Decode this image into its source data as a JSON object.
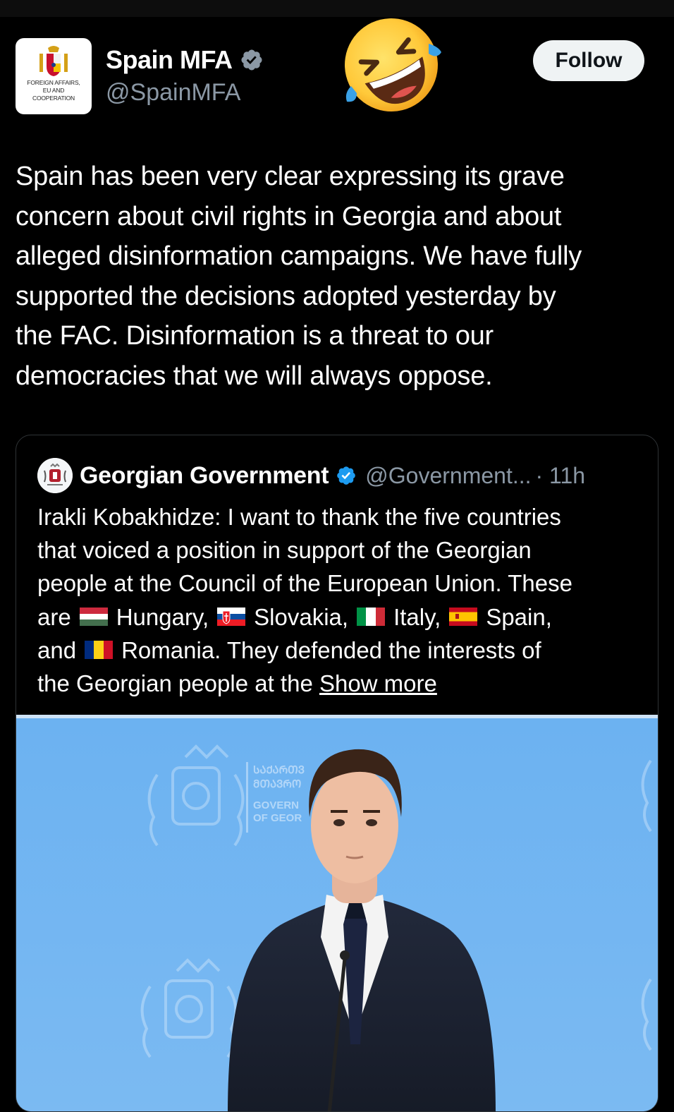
{
  "post": {
    "author_name": "Spain MFA",
    "author_handle": "@SpainMFA",
    "avatar_text": [
      "FOREIGN AFFAIRS,",
      "EU AND",
      "COOPERATION"
    ],
    "follow_label": "Follow",
    "emoji": "rolling-on-the-floor-laughing",
    "text_lines": [
      "Spain has been very clear expressing its grave",
      "concern about civil rights in Georgia and about",
      "alleged disinformation campaigns. We have fully",
      "supported the decisions adopted yesterday by",
      "the FAC. Disinformation is a threat to our",
      "democracies that we will always oppose."
    ]
  },
  "quote": {
    "author_name": "Georgian Government",
    "author_handle": "@Government...",
    "time": "· 11h",
    "line1": "Irakli Kobakhidze: I want to thank the five countries",
    "line2": "that voiced a position in support of the Georgian",
    "line3": "people at the Council of the European Union. These",
    "line4_a": "are",
    "line4_b": "Hungary,",
    "line4_c": "Slovakia,",
    "line4_d": "Italy,",
    "line4_e": "Spain,",
    "line5_a": "and",
    "line5_b": "Romania. They defended the interests of",
    "line6_a": "the Georgian people at the ",
    "show_more": "Show more",
    "image_sign_text": [
      "ᲡᲐᲥᲐᲠᲗᲕ",
      "ᲛᲗᲐᲕᲠᲝ",
      "GOVERN",
      "OF GEOR"
    ]
  },
  "colors": {
    "background": "#000000",
    "text": "#ffffff",
    "secondary": "#8b98a5",
    "verified": "#1d9bf0",
    "follow_bg": "#eff3f4",
    "border": "#2f3336"
  }
}
